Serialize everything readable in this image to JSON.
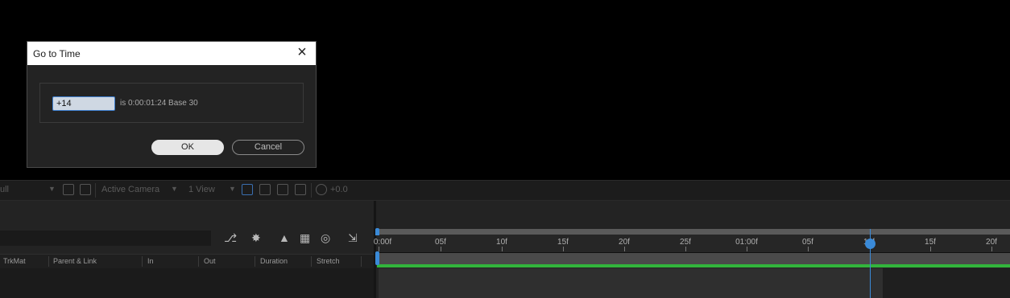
{
  "dialog": {
    "title": "Go to Time",
    "input_value": "+14",
    "equivalent_text": "is 0:00:01:24  Base 30",
    "ok_label": "OK",
    "cancel_label": "Cancel"
  },
  "viewer_toolbar": {
    "resolution": "ull",
    "camera": "Active Camera",
    "views": "1 View",
    "exposure": "+0.0"
  },
  "timeline": {
    "columns": [
      "TrkMat",
      "Parent & Link",
      "In",
      "Out",
      "Duration",
      "Stretch"
    ],
    "ruler_labels": [
      "0:00f",
      "05f",
      "10f",
      "15f",
      "20f",
      "25f",
      "01:00f",
      "05f",
      "10f",
      "15f",
      "20f"
    ]
  },
  "colors": {
    "accent": "#3a8ad8",
    "work_area_green": "#32b43c",
    "dialog_bg": "#232323"
  }
}
